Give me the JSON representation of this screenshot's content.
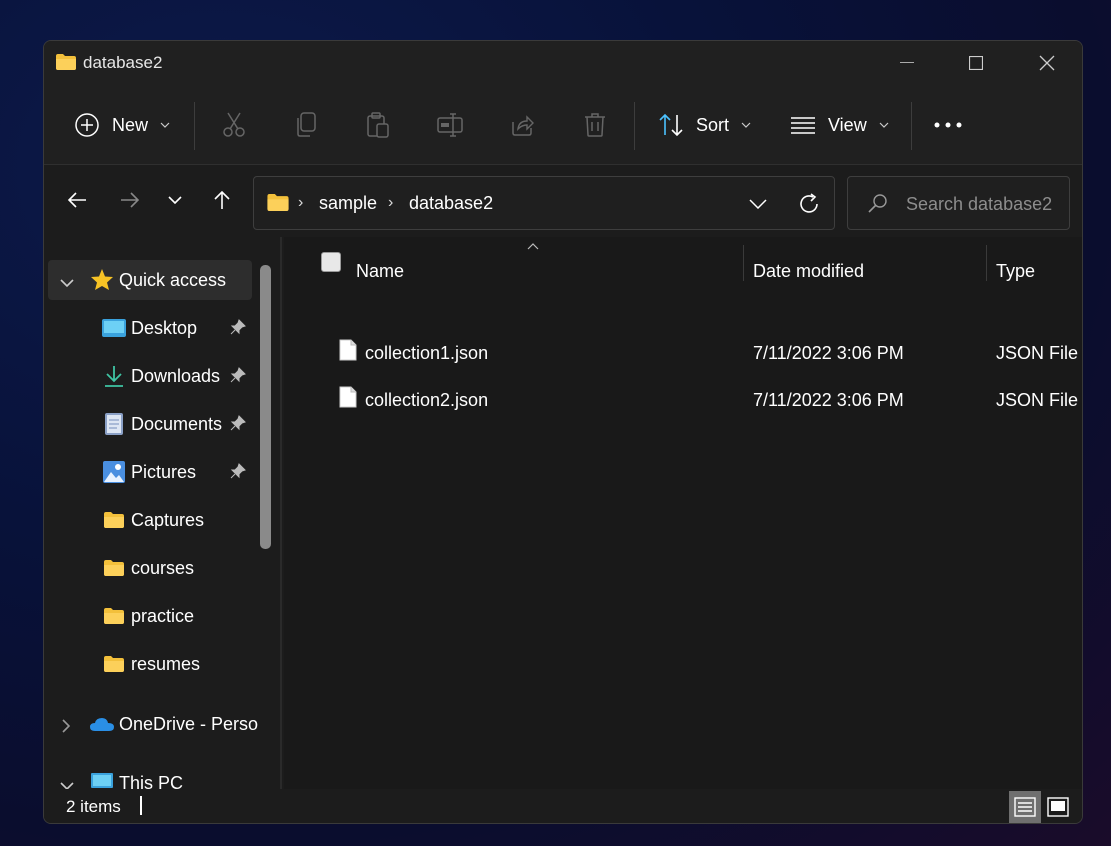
{
  "window": {
    "title": "database2"
  },
  "toolbar": {
    "new_label": "New",
    "sort_label": "Sort",
    "view_label": "View",
    "more_label": "•••"
  },
  "address": {
    "crumbs": [
      "sample",
      "database2"
    ]
  },
  "search": {
    "placeholder": "Search database2"
  },
  "sidebar": {
    "items": [
      {
        "label": "Quick access",
        "icon": "star-icon",
        "selected": true
      },
      {
        "label": "Desktop",
        "icon": "desktop-icon",
        "pinned": true
      },
      {
        "label": "Downloads",
        "icon": "download-icon",
        "pinned": true
      },
      {
        "label": "Documents",
        "icon": "document-icon",
        "pinned": true
      },
      {
        "label": "Pictures",
        "icon": "pictures-icon",
        "pinned": true
      },
      {
        "label": "Captures",
        "icon": "folder-icon"
      },
      {
        "label": "courses",
        "icon": "folder-icon"
      },
      {
        "label": "practice",
        "icon": "folder-icon"
      },
      {
        "label": "resumes",
        "icon": "folder-icon"
      },
      {
        "label": "OneDrive - Perso",
        "icon": "cloud-icon"
      },
      {
        "label": "This PC",
        "icon": "pc-icon"
      }
    ]
  },
  "columns": {
    "name": "Name",
    "date": "Date modified",
    "type": "Type"
  },
  "files": [
    {
      "name": "collection1.json",
      "date": "7/11/2022 3:06 PM",
      "type": "JSON File"
    },
    {
      "name": "collection2.json",
      "date": "7/11/2022 3:06 PM",
      "type": "JSON File"
    }
  ],
  "status": {
    "count": "2 items"
  },
  "colors": {
    "folder": "#f3c03b",
    "background": "#1c1c1c",
    "accent": "#4cc2ff"
  }
}
